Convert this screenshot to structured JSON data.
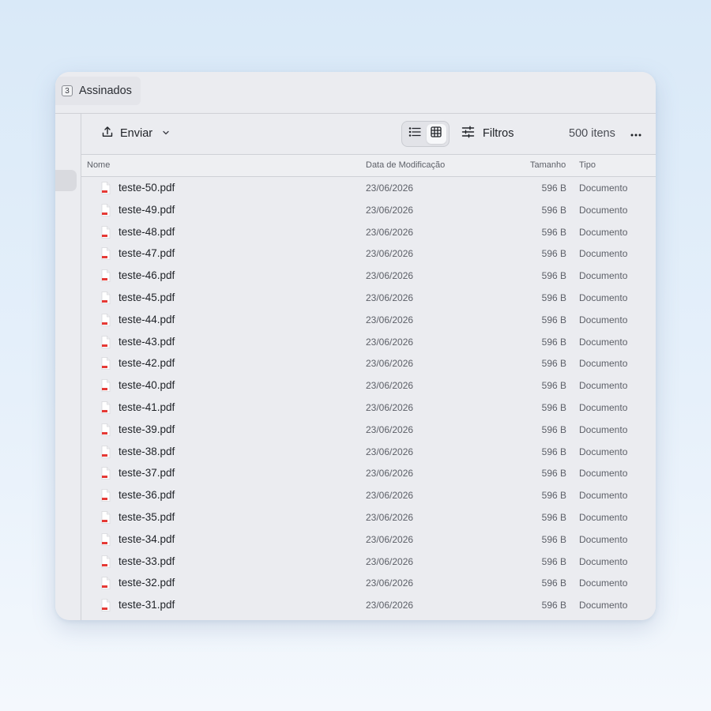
{
  "tab": {
    "badge": "3",
    "label": "Assinados"
  },
  "toolbar": {
    "upload_label": "Enviar",
    "filters_label": "Filtros",
    "item_count": "500 itens",
    "upload_icon": "upload-icon",
    "list_view_icon": "list-view-icon",
    "grid_view_icon": "grid-view-icon",
    "filters_icon": "sliders-icon",
    "more_icon": "more-horizontal-icon",
    "active_view": "list"
  },
  "columns": {
    "name": "Nome",
    "date": "Data de Modificação",
    "size": "Tamanho",
    "type": "Tipo"
  },
  "files": [
    {
      "name": "teste-50.pdf",
      "date": "23/06/2026",
      "size": "596 B",
      "type": "Documento"
    },
    {
      "name": "teste-49.pdf",
      "date": "23/06/2026",
      "size": "596 B",
      "type": "Documento"
    },
    {
      "name": "teste-48.pdf",
      "date": "23/06/2026",
      "size": "596 B",
      "type": "Documento"
    },
    {
      "name": "teste-47.pdf",
      "date": "23/06/2026",
      "size": "596 B",
      "type": "Documento"
    },
    {
      "name": "teste-46.pdf",
      "date": "23/06/2026",
      "size": "596 B",
      "type": "Documento"
    },
    {
      "name": "teste-45.pdf",
      "date": "23/06/2026",
      "size": "596 B",
      "type": "Documento"
    },
    {
      "name": "teste-44.pdf",
      "date": "23/06/2026",
      "size": "596 B",
      "type": "Documento"
    },
    {
      "name": "teste-43.pdf",
      "date": "23/06/2026",
      "size": "596 B",
      "type": "Documento"
    },
    {
      "name": "teste-42.pdf",
      "date": "23/06/2026",
      "size": "596 B",
      "type": "Documento"
    },
    {
      "name": "teste-40.pdf",
      "date": "23/06/2026",
      "size": "596 B",
      "type": "Documento"
    },
    {
      "name": "teste-41.pdf",
      "date": "23/06/2026",
      "size": "596 B",
      "type": "Documento"
    },
    {
      "name": "teste-39.pdf",
      "date": "23/06/2026",
      "size": "596 B",
      "type": "Documento"
    },
    {
      "name": "teste-38.pdf",
      "date": "23/06/2026",
      "size": "596 B",
      "type": "Documento"
    },
    {
      "name": "teste-37.pdf",
      "date": "23/06/2026",
      "size": "596 B",
      "type": "Documento"
    },
    {
      "name": "teste-36.pdf",
      "date": "23/06/2026",
      "size": "596 B",
      "type": "Documento"
    },
    {
      "name": "teste-35.pdf",
      "date": "23/06/2026",
      "size": "596 B",
      "type": "Documento"
    },
    {
      "name": "teste-34.pdf",
      "date": "23/06/2026",
      "size": "596 B",
      "type": "Documento"
    },
    {
      "name": "teste-33.pdf",
      "date": "23/06/2026",
      "size": "596 B",
      "type": "Documento"
    },
    {
      "name": "teste-32.pdf",
      "date": "23/06/2026",
      "size": "596 B",
      "type": "Documento"
    },
    {
      "name": "teste-31.pdf",
      "date": "23/06/2026",
      "size": "596 B",
      "type": "Documento"
    }
  ],
  "colors": {
    "pdf_accent": "#e53935",
    "selection": "#d9dadf",
    "window_bg": "#ebecf0"
  }
}
